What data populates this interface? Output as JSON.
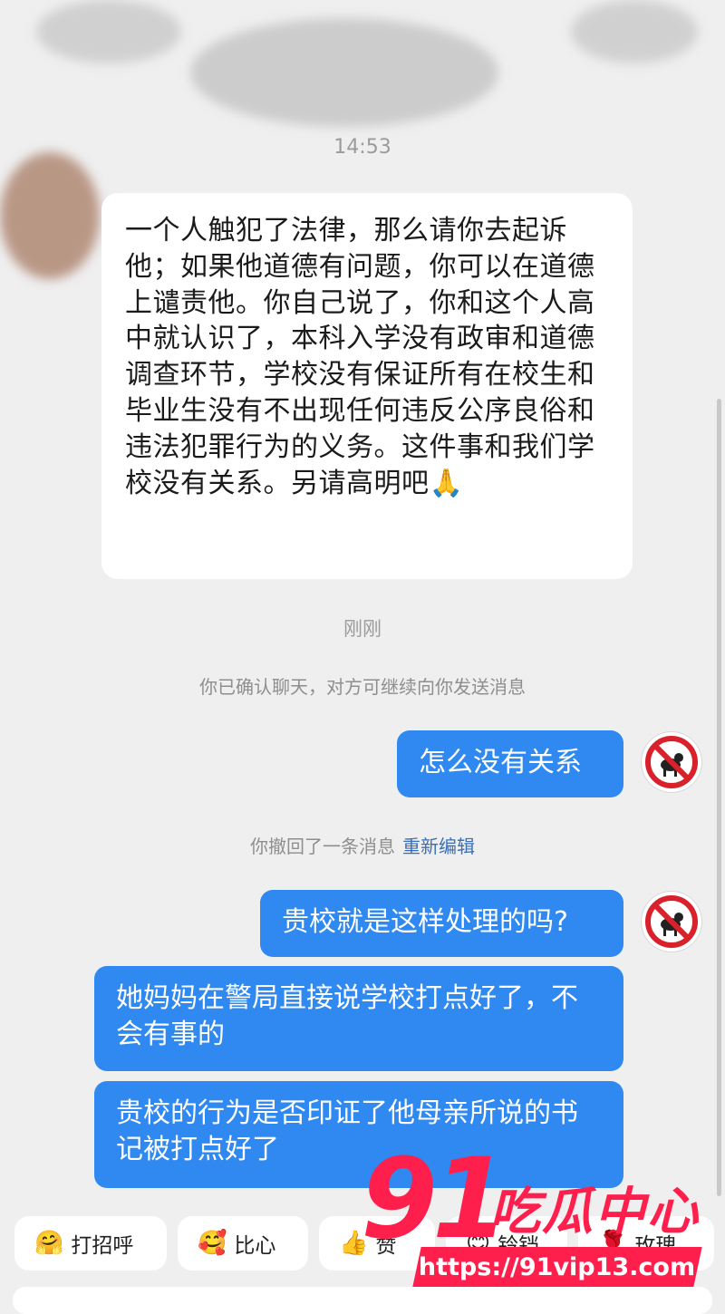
{
  "chat": {
    "timestamp_1": "14:53",
    "incoming_message": "一个人触犯了法律，那么请你去起诉他；如果他道德有问题，你可以在道德上谴责他。你自己说了，你和这个人高中就认识了，本科入学没有政审和道德调查环节，学校没有保证所有在校生和毕业生没有不出现任何违反公序良俗和违法犯罪行为的义务。这件事和我们学校没有关系。另请高明吧",
    "incoming_emoji": "🙏",
    "timestamp_2": "刚刚",
    "system_confirm": "你已确认聊天，对方可继续向你发送消息",
    "outgoing_1": "怎么没有关系",
    "recall_notice": "你撤回了一条消息",
    "recall_edit": "重新编辑",
    "outgoing_2": "贵校就是这样处理的吗?",
    "outgoing_3": "她妈妈在警局直接说学校打点好了，不会有事的",
    "outgoing_4": "贵校的行为是否印证了他母亲所说的书记被打点好了"
  },
  "quick_replies": [
    {
      "icon": "hug-emoji-icon",
      "label": "打招呼"
    },
    {
      "icon": "heart-emoji-icon",
      "label": "比心"
    },
    {
      "icon": "thumbs-up-icon",
      "label": "赞"
    },
    {
      "icon": "face-emoji-icon",
      "label": "铃铛"
    },
    {
      "icon": "rose-icon",
      "label": "玫瑰"
    }
  ],
  "watermark": {
    "number": "91",
    "title": "吃瓜中心",
    "url": "https://91vip13.com"
  },
  "colors": {
    "background": "#efeff0",
    "outgoing_bubble": "#2f89f0",
    "incoming_bubble": "#ffffff",
    "link": "#3a6fb8",
    "watermark": "#ff1f4d"
  }
}
